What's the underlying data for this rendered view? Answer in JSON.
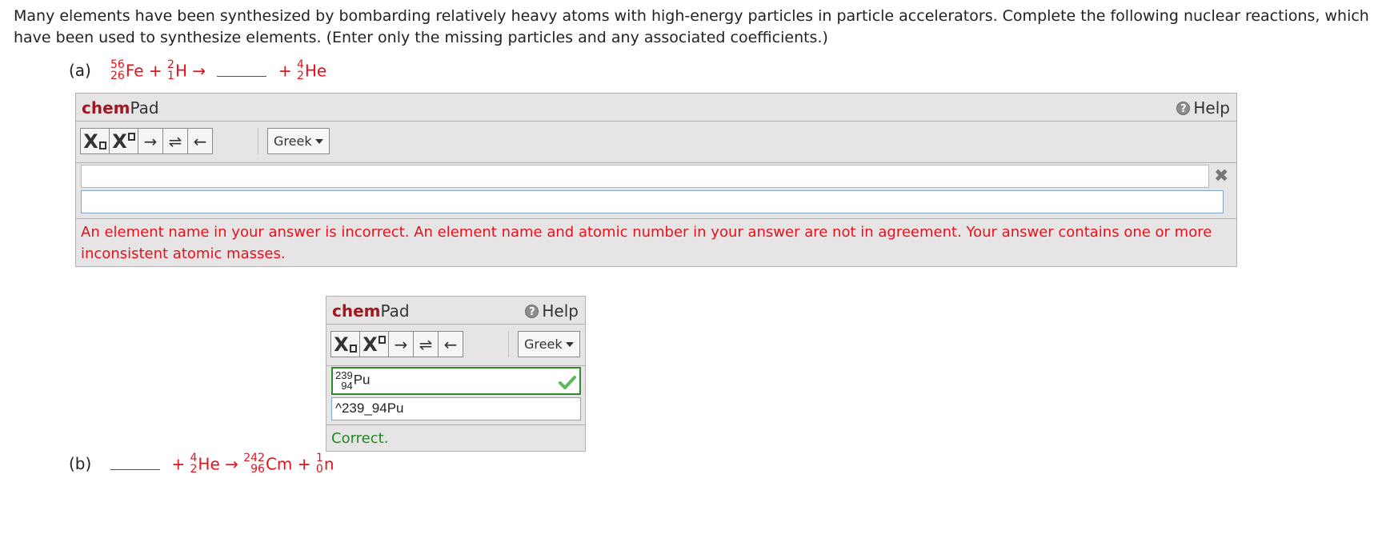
{
  "question": {
    "intro": "Many elements have been synthesized by bombarding relatively heavy atoms with high-energy particles in particle accelerators. Complete the following nuclear reactions, which have been used to synthesize elements. (Enter only the missing particles and any associated coefficients.)"
  },
  "part_a": {
    "label": "(a)",
    "reactant1": {
      "mass": "56",
      "z": "26",
      "symbol": "Fe"
    },
    "plus1": "+",
    "reactant2": {
      "mass": "2",
      "z": "1",
      "symbol": "H"
    },
    "arrow": "→",
    "plus2": "+",
    "product2": {
      "mass": "4",
      "z": "2",
      "symbol": "He"
    },
    "chempad": {
      "title_bold": "chem",
      "title_rest": "Pad",
      "help_label": "Help",
      "subscript_btn": "X",
      "superscript_btn": "X",
      "arrow_btn": "→",
      "equilibrium_btn": "⇌",
      "back_arrow_btn": "←",
      "greek_label": "Greek",
      "preview": "",
      "input_value": "",
      "feedback": "An element name in your answer is incorrect. An element name and atomic number in your answer are not in agreement. Your answer contains one or more inconsistent atomic masses.",
      "feedback_color": "#e8101a"
    }
  },
  "part_b": {
    "label": "(b)",
    "plus1": "+",
    "reactant2": {
      "mass": "4",
      "z": "2",
      "symbol": "He"
    },
    "arrow": "→",
    "product1": {
      "mass": "242",
      "z": "96",
      "symbol": "Cm"
    },
    "plus2": "+",
    "product2": {
      "mass": "1",
      "z": "0",
      "symbol": "n"
    },
    "chempad": {
      "title_bold": "chem",
      "title_rest": "Pad",
      "help_label": "Help",
      "subscript_btn": "X",
      "superscript_btn": "X",
      "arrow_btn": "→",
      "equilibrium_btn": "⇌",
      "back_arrow_btn": "←",
      "greek_label": "Greek",
      "preview": {
        "mass": "239",
        "z": "94",
        "symbol": "Pu"
      },
      "input_value": "^239_94Pu",
      "feedback": "Correct.",
      "feedback_color": "#1f8a1f"
    }
  },
  "colors": {
    "reaction_text": "#e8101a",
    "panel_bg": "#e7e4e5",
    "brand_red": "#a31520",
    "check_green": "#5cb85c"
  }
}
